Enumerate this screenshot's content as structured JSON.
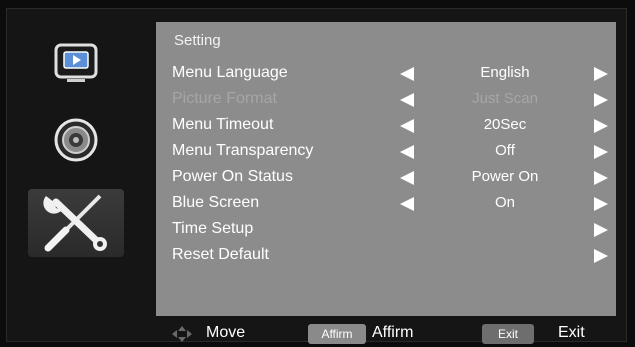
{
  "sidebar": {
    "icons": [
      "picture-icon",
      "sound-icon",
      "settings-tools-icon"
    ]
  },
  "panel": {
    "title": "Setting",
    "rows": [
      {
        "label": "Menu Language",
        "value": "English",
        "has_left": true,
        "has_right": true,
        "disabled": false
      },
      {
        "label": "Picture Format",
        "value": "Just Scan",
        "has_left": true,
        "has_right": true,
        "disabled": true
      },
      {
        "label": "Menu Timeout",
        "value": "20Sec",
        "has_left": true,
        "has_right": true,
        "disabled": false
      },
      {
        "label": "Menu Transparency",
        "value": "Off",
        "has_left": true,
        "has_right": true,
        "disabled": false
      },
      {
        "label": "Power On Status",
        "value": "Power On",
        "has_left": true,
        "has_right": true,
        "disabled": false
      },
      {
        "label": "Blue Screen",
        "value": "On",
        "has_left": true,
        "has_right": true,
        "disabled": false
      },
      {
        "label": "Time Setup",
        "value": "",
        "has_left": false,
        "has_right": true,
        "disabled": false
      },
      {
        "label": "Reset Default",
        "value": "",
        "has_left": false,
        "has_right": true,
        "disabled": false
      }
    ]
  },
  "footer": {
    "move_label": "Move",
    "affirm_badge": "Affirm",
    "affirm_label": "Affirm",
    "exit_badge": "Exit",
    "exit_label": "Exit"
  }
}
